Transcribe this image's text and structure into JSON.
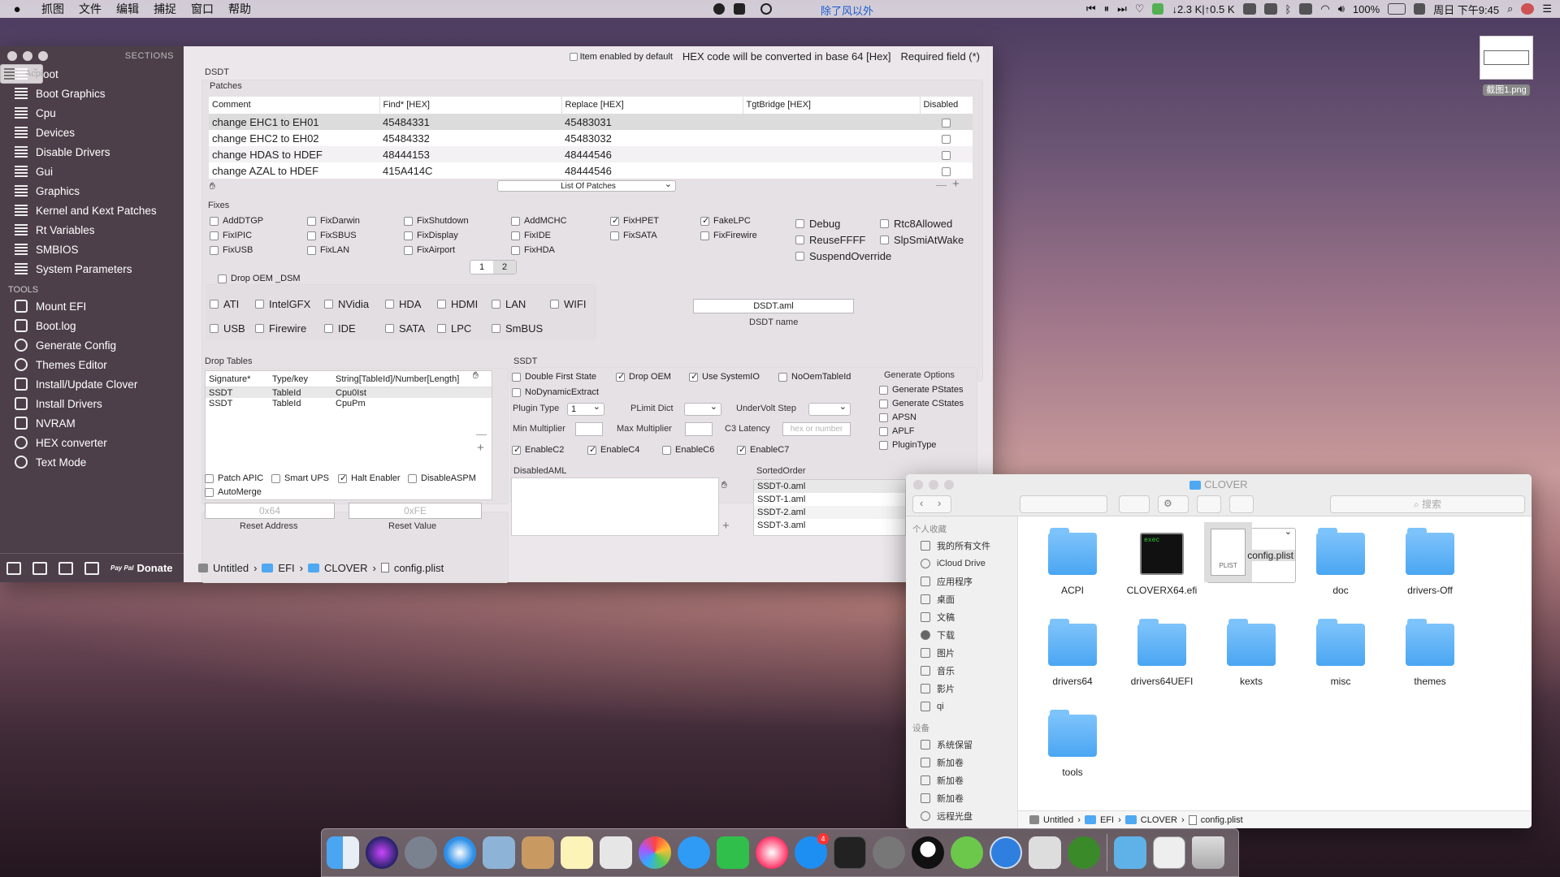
{
  "menubar": {
    "apple": "",
    "items": [
      "抓图",
      "文件",
      "编辑",
      "捕捉",
      "窗口",
      "帮助"
    ],
    "center_text": "除了风以外",
    "net_speed": "↓2.3 K|↑0.5 K",
    "battery": "100%",
    "clock": "周日 下午9:45"
  },
  "desktop_file": {
    "name": "截图1.png"
  },
  "clover": {
    "sidebar": {
      "sections_header": "SECTIONS",
      "sections": [
        "Acpi",
        "Boot",
        "Boot Graphics",
        "Cpu",
        "Devices",
        "Disable Drivers",
        "Gui",
        "Graphics",
        "Kernel and Kext Patches",
        "Rt Variables",
        "SMBIOS",
        "System Parameters"
      ],
      "tools_header": "TOOLS",
      "tools": [
        "Mount EFI",
        "Boot.log",
        "Generate Config",
        "Themes Editor",
        "Install/Update Clover",
        "Install Drivers",
        "NVRAM",
        "HEX converter",
        "Text Mode"
      ],
      "donate_label": "Donate",
      "paypal_text": "Pay Pal"
    },
    "legend": {
      "item_enabled": "Item enabled by default",
      "hex_note": "HEX code will be converted in base 64 [Hex]",
      "required": "Required field (*)"
    },
    "dsdt": {
      "title": "DSDT",
      "patches_label": "Patches",
      "columns": [
        "Comment",
        "Find* [HEX]",
        "Replace [HEX]",
        "TgtBridge [HEX]",
        "Disabled"
      ],
      "rows": [
        {
          "comment": "change EHC1 to EH01",
          "find": "45484331",
          "replace": "45483031",
          "tgt": ""
        },
        {
          "comment": "change EHC2 to EH02",
          "find": "45484332",
          "replace": "45483032",
          "tgt": ""
        },
        {
          "comment": "change HDAS to HDEF",
          "find": "48444153",
          "replace": "48444546",
          "tgt": ""
        },
        {
          "comment": "change AZAL to HDEF",
          "find": "415A414C",
          "replace": "48444546",
          "tgt": ""
        }
      ],
      "list_select": "List Of Patches",
      "minus": "—",
      "plus": "+",
      "fixes_label": "Fixes",
      "fixes": [
        [
          "AddDTGP",
          "FixDarwin",
          "FixShutdown",
          "AddMCHC",
          "FixHPET",
          "FakeLPC"
        ],
        [
          "FixIPIC",
          "FixSBUS",
          "FixDisplay",
          "FixIDE",
          "FixSATA",
          "FixFirewire"
        ],
        [
          "FixUSB",
          "FixLAN",
          "FixAirport",
          "FixHDA",
          "",
          ""
        ]
      ],
      "fix_tabs": [
        "1",
        "2"
      ],
      "extra": [
        "Debug",
        "Rtc8Allowed",
        "ReuseFFFF",
        "SlpSmiAtWake",
        "SuspendOverride"
      ],
      "drop_oem_dsm": "Drop OEM _DSM",
      "dsm_row1": [
        "ATI",
        "IntelGFX",
        "NVidia",
        "HDA",
        "HDMI",
        "LAN",
        "WIFI"
      ],
      "dsm_row2": [
        "USB",
        "Firewire",
        "IDE",
        "SATA",
        "LPC",
        "SmBUS"
      ],
      "dsdt_name_value": "DSDT.aml",
      "dsdt_name_label": "DSDT name"
    },
    "drop_tables": {
      "title": "Drop Tables",
      "columns": [
        "Signature*",
        "Type/key",
        "String[TableId]/Number[Length]"
      ],
      "rows": [
        {
          "sig": "SSDT",
          "type": "TableId",
          "str": "Cpu0Ist"
        },
        {
          "sig": "SSDT",
          "type": "TableId",
          "str": "CpuPm"
        }
      ]
    },
    "ssdt": {
      "title": "SSDT",
      "checks1": [
        "Double First State",
        "Drop OEM",
        "Use SystemIO",
        "NoOemTableId"
      ],
      "nodynamic": "NoDynamicExtract",
      "plugin_type_label": "Plugin Type",
      "plugin_type_value": "1",
      "plimit_label": "PLimit Dict",
      "undervolt_label": "UnderVolt Step",
      "min_mult_label": "Min Multiplier",
      "max_mult_label": "Max Multiplier",
      "c3_label": "C3 Latency",
      "c3_placeholder": "hex or number",
      "enable_c": [
        "EnableC2",
        "EnableC4",
        "EnableC6",
        "EnableC7"
      ],
      "gen_options_title": "Generate Options",
      "gen_options": [
        "Generate PStates",
        "Generate CStates",
        "APSN",
        "APLF",
        "PluginType"
      ]
    },
    "bottom_left": {
      "checks": [
        "Patch APIC",
        "Smart UPS",
        "Halt Enabler",
        "DisableASPM"
      ],
      "automerge": "AutoMerge",
      "reset_address_ph": "0x64",
      "reset_value_ph": "0xFE",
      "reset_address_label": "Reset Address",
      "reset_value_label": "Reset Value"
    },
    "disabled_aml": {
      "title": "DisabledAML"
    },
    "sorted_order": {
      "title": "SortedOrder",
      "items": [
        "SSDT-0.aml",
        "SSDT-1.aml",
        "SSDT-2.aml",
        "SSDT-3.aml"
      ]
    },
    "path": [
      "Untitled",
      "EFI",
      "CLOVER",
      "config.plist"
    ]
  },
  "finder": {
    "title": "CLOVER",
    "search_placeholder": "搜索",
    "favorites_header": "个人收藏",
    "favorites": [
      "我的所有文件",
      "iCloud Drive",
      "应用程序",
      "桌面",
      "文稿",
      "下载",
      "图片",
      "音乐",
      "影片",
      "qi"
    ],
    "devices_header": "设备",
    "devices": [
      "系统保留",
      "新加卷",
      "新加卷",
      "新加卷",
      "远程光盘"
    ],
    "items": [
      "ACPI",
      "CLOVERX64.efi",
      "config.plist",
      "doc",
      "drivers-Off",
      "drivers64",
      "drivers64UEFI",
      "kexts",
      "misc",
      "themes",
      "tools"
    ],
    "exec_label": "exec",
    "plist_label": "PLIST",
    "path": [
      "Untitled",
      "EFI",
      "CLOVER",
      "config.plist"
    ]
  },
  "dock": {
    "apps": [
      "Finder",
      "Siri",
      "Launchpad",
      "Safari",
      "Preview",
      "Contacts",
      "Notes",
      "Photos Browser",
      "Photos",
      "Messages",
      "FaceTime",
      "iTunes",
      "App Store",
      "Activity Monitor",
      "System Preferences",
      "QQ",
      "WeChat",
      "Clover Configurator",
      "Keychain",
      "Vibrant",
      "Xcode",
      "Screenshot",
      "Trash"
    ],
    "appstore_badge": "4"
  }
}
